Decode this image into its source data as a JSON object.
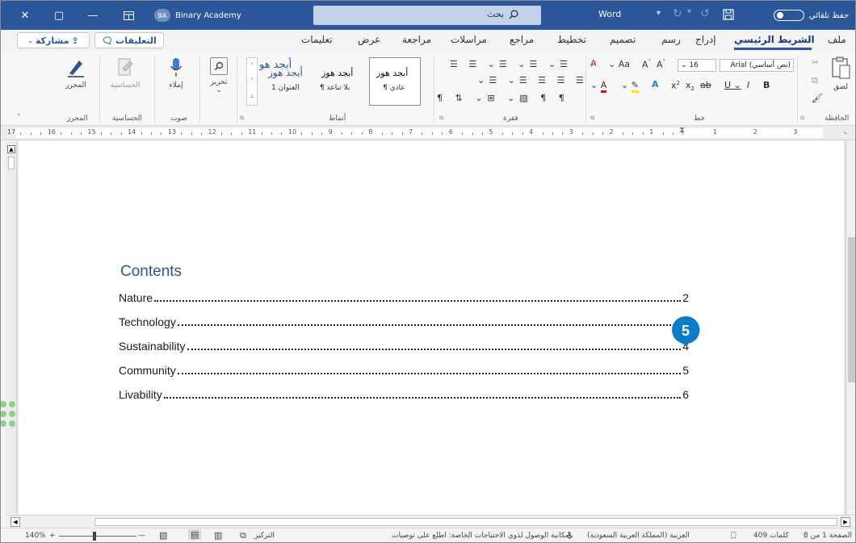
{
  "titlebar": {
    "search_text": "بحث",
    "brand_initials": "BA",
    "brand_name": "Binary Academy",
    "app_name": "Word",
    "autosave_label": "حفظ تلقائي",
    "accent": "#2b579a"
  },
  "tabs": {
    "file": "ملف",
    "home": "الشريط الرئيسي",
    "insert": "إدراج",
    "draw": "رسم",
    "design": "تصميم",
    "layout": "تخطيط",
    "references": "مراجع",
    "mailings": "مراسلات",
    "review": "مراجعة",
    "view": "عرض",
    "help": "تعليمات",
    "comments": "التعليقات",
    "share": "مشاركة"
  },
  "ribbon": {
    "clipboard": {
      "paste": "لصق",
      "label": "الحافظة"
    },
    "font": {
      "font_name": "Arial",
      "font_placeholder": "(نص أساسي)",
      "font_size": "16",
      "label": "خط"
    },
    "paragraph": {
      "label": "فقرة"
    },
    "styles": {
      "label": "أنماط",
      "items": [
        {
          "sample": "أبجد هوز",
          "name": "¶ عادي"
        },
        {
          "sample": "أبجد هوز",
          "name": "¶ بلا تباعد"
        },
        {
          "sample": "أبجد هوز",
          "name": "العنوان 1"
        },
        {
          "sample": "أبجد هو"
        }
      ]
    },
    "editing": {
      "label": "تحرير"
    },
    "voice": {
      "dictate": "إملاء",
      "label": "صوت"
    },
    "sensitivity": {
      "button": "الحساسية",
      "label": "الحساسية"
    },
    "editor": {
      "button": "المحرر",
      "label": "المحرر"
    }
  },
  "ruler": {
    "numbers_left": [
      "17",
      "16",
      "15",
      "14",
      "13",
      "12",
      "11",
      "10",
      "9",
      "8",
      "7",
      "6",
      "5",
      "4",
      "3",
      "2",
      "1"
    ],
    "numbers_right": [
      "1",
      "2",
      "3"
    ]
  },
  "document": {
    "toc_title": "Contents",
    "toc_entries": [
      {
        "label": "Nature",
        "page": "2"
      },
      {
        "label": "Technology",
        "page": "3"
      },
      {
        "label": "Sustainability",
        "page": "4"
      },
      {
        "label": "Community",
        "page": "5"
      },
      {
        "label": "Livability",
        "page": "6"
      }
    ],
    "badge_number": "5",
    "badge_color": "#0d7cc8"
  },
  "statusbar": {
    "page": "الصفحة 1 من 8",
    "words": "409 كلمات",
    "language": "العربية (المملكة العربية السعودية)",
    "accessibility": "إمكانية الوصول لذوي الاحتياجات الخاصة: اطلع على توصيات",
    "focus": "التركيز",
    "zoom": "140%"
  }
}
